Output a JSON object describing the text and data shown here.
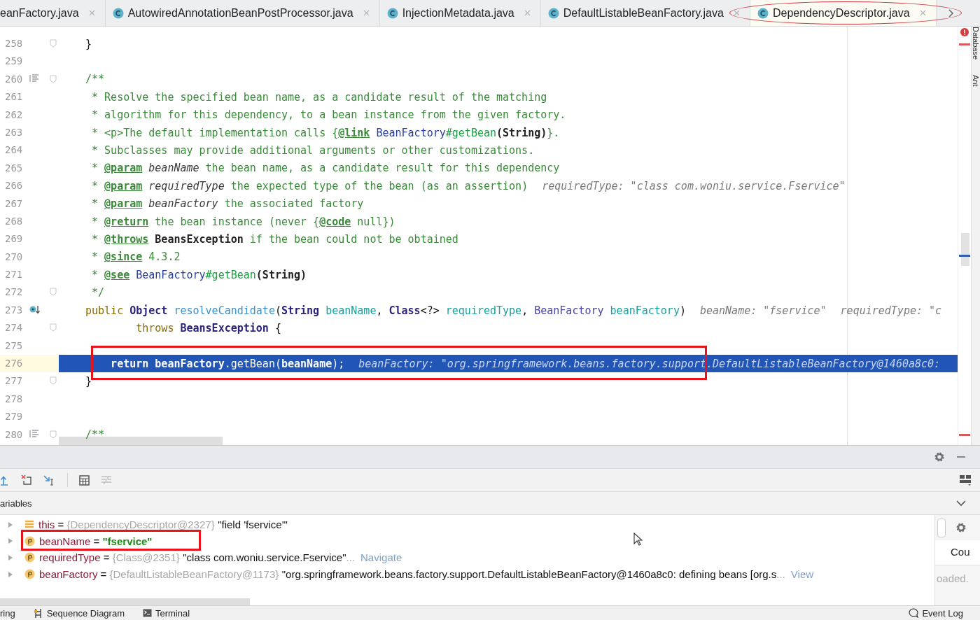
{
  "tabs": [
    {
      "label": "eanFactory.java",
      "kind": "cut",
      "selected": false,
      "annotated": false
    },
    {
      "label": "AutowiredAnnotationBeanPostProcessor.java",
      "kind": "class",
      "selected": false,
      "annotated": false
    },
    {
      "label": "InjectionMetadata.java",
      "kind": "class",
      "selected": false,
      "annotated": false
    },
    {
      "label": "DefaultListableBeanFactory.java",
      "kind": "class",
      "selected": false,
      "annotated": false
    },
    {
      "label": "DependencyDescriptor.java",
      "kind": "class",
      "selected": true,
      "annotated": true
    }
  ],
  "editor": {
    "lines": [
      {
        "number": "258",
        "fold": true,
        "current": false,
        "annotated": false,
        "tokens": [
          {
            "kind": "plain",
            "text": "}"
          }
        ]
      },
      {
        "number": "259",
        "fold": false,
        "current": false,
        "annotated": false
      },
      {
        "number": "260",
        "gutter_icon": {
          "kind": "javadoc"
        },
        "fold": true,
        "current": false,
        "annotated": false,
        "tokens": [
          {
            "kind": "comment",
            "text": "/**"
          }
        ]
      },
      {
        "number": "261",
        "fold": false,
        "current": false,
        "annotated": false,
        "tokens": [
          {
            "kind": "comment",
            "text": " * Resolve the specified bean name, as a candidate result of the matching"
          }
        ]
      },
      {
        "number": "262",
        "fold": false,
        "current": false,
        "annotated": false,
        "tokens": [
          {
            "kind": "comment",
            "text": " * algorithm for this dependency, to a bean instance from the given factory."
          }
        ]
      },
      {
        "number": "263",
        "fold": false,
        "current": false,
        "annotated": false,
        "tokens": [
          {
            "kind": "comment",
            "text": " * "
          },
          {
            "kind": "html",
            "text": "<p>"
          },
          {
            "kind": "comment",
            "text": "The default implementation calls {"
          },
          {
            "kind": "tag",
            "text": "@link"
          },
          {
            "kind": "docref",
            "text": " BeanFactory"
          },
          {
            "kind": "docmember",
            "text": "#getBean"
          },
          {
            "kind": "docbold",
            "text": "(String)"
          },
          {
            "kind": "comment",
            "text": "}."
          }
        ]
      },
      {
        "number": "264",
        "fold": false,
        "current": false,
        "annotated": false,
        "tokens": [
          {
            "kind": "comment",
            "text": " * Subclasses may provide additional arguments or other customizations."
          }
        ]
      },
      {
        "number": "265",
        "fold": false,
        "current": false,
        "annotated": false,
        "tokens": [
          {
            "kind": "comment",
            "text": " * "
          },
          {
            "kind": "tag",
            "text": "@param"
          },
          {
            "kind": "docparam",
            "text": " beanName"
          },
          {
            "kind": "comment",
            "text": " the bean name, as a candidate result for this dependency"
          }
        ]
      },
      {
        "number": "266",
        "fold": false,
        "current": false,
        "annotated": false,
        "tokens": [
          {
            "kind": "comment",
            "text": " * "
          },
          {
            "kind": "tag",
            "text": "@param"
          },
          {
            "kind": "docparam",
            "text": " requiredType"
          },
          {
            "kind": "comment",
            "text": " the expected type of the bean (as an assertion)"
          }
        ],
        "hints": [
          "requiredType: \"class com.woniu.service.Fservice\""
        ]
      },
      {
        "number": "267",
        "fold": false,
        "current": false,
        "annotated": false,
        "tokens": [
          {
            "kind": "comment",
            "text": " * "
          },
          {
            "kind": "tag",
            "text": "@param"
          },
          {
            "kind": "docparam",
            "text": " beanFactory"
          },
          {
            "kind": "comment",
            "text": " the associated factory"
          }
        ]
      },
      {
        "number": "268",
        "fold": false,
        "current": false,
        "annotated": false,
        "tokens": [
          {
            "kind": "comment",
            "text": " * "
          },
          {
            "kind": "tag",
            "text": "@return"
          },
          {
            "kind": "comment",
            "text": " the bean instance (never {"
          },
          {
            "kind": "tag",
            "text": "@code"
          },
          {
            "kind": "comment",
            "text": " null})"
          }
        ]
      },
      {
        "number": "269",
        "fold": false,
        "current": false,
        "annotated": false,
        "tokens": [
          {
            "kind": "comment",
            "text": " * "
          },
          {
            "kind": "tag",
            "text": "@throws"
          },
          {
            "kind": "docbold",
            "text": " BeansException"
          },
          {
            "kind": "comment",
            "text": " if the bean could not be obtained"
          }
        ]
      },
      {
        "number": "270",
        "fold": false,
        "current": false,
        "annotated": false,
        "tokens": [
          {
            "kind": "comment",
            "text": " * "
          },
          {
            "kind": "tag",
            "text": "@since"
          },
          {
            "kind": "comment",
            "text": " 4.3.2"
          }
        ]
      },
      {
        "number": "271",
        "fold": false,
        "current": false,
        "annotated": false,
        "tokens": [
          {
            "kind": "comment",
            "text": " * "
          },
          {
            "kind": "tag",
            "text": "@see"
          },
          {
            "kind": "docref",
            "text": " BeanFactory"
          },
          {
            "kind": "docmember",
            "text": "#getBean"
          },
          {
            "kind": "docbold",
            "text": "(String)"
          }
        ]
      },
      {
        "number": "272",
        "fold": true,
        "current": false,
        "annotated": false,
        "tokens": [
          {
            "kind": "comment",
            "text": " */"
          }
        ]
      },
      {
        "number": "273",
        "gutter_icon": {
          "kind": "override"
        },
        "fold": false,
        "current": false,
        "annotated": false,
        "tokens": [
          {
            "kind": "keyword",
            "text": "public "
          },
          {
            "kind": "type",
            "text": "Object "
          },
          {
            "kind": "method",
            "text": "resolveCandidate"
          },
          {
            "kind": "plain",
            "text": "("
          },
          {
            "kind": "type",
            "text": "String "
          },
          {
            "kind": "param",
            "text": "beanName"
          },
          {
            "kind": "plain",
            "text": ", "
          },
          {
            "kind": "type",
            "text": "Class"
          },
          {
            "kind": "plain",
            "text": "<?> "
          },
          {
            "kind": "param",
            "text": "requiredType"
          },
          {
            "kind": "plain",
            "text": ", "
          },
          {
            "kind": "type2",
            "text": "BeanFactory "
          },
          {
            "kind": "param",
            "text": "beanFactory"
          },
          {
            "kind": "plain",
            "text": ")"
          }
        ],
        "hints": [
          "beanName: \"fservice\"",
          "requiredType: \"c"
        ]
      },
      {
        "number": "274",
        "fold": true,
        "current": false,
        "annotated": false,
        "tokens": [
          {
            "kind": "keyword",
            "text": "        throws "
          },
          {
            "kind": "type",
            "text": "BeansException"
          },
          {
            "kind": "plain",
            "text": " {"
          }
        ]
      },
      {
        "number": "275",
        "fold": false,
        "current": false,
        "annotated": false
      },
      {
        "number": "276",
        "fold": false,
        "current": true,
        "annotated": true,
        "tokens": [
          {
            "kind": "keyword",
            "text": "    return "
          },
          {
            "kind": "bold",
            "text": "beanFactory"
          },
          {
            "kind": "plain",
            "text": ".getBean("
          },
          {
            "kind": "bold",
            "text": "beanName"
          },
          {
            "kind": "plain",
            "text": ");"
          }
        ],
        "hints": [
          "beanFactory: \"org.springframework.beans.factory.support.DefaultListableBeanFactory@1460a8c0:"
        ]
      },
      {
        "number": "277",
        "fold": true,
        "current": false,
        "annotated": false,
        "tokens": [
          {
            "kind": "plain",
            "text": "}"
          }
        ]
      },
      {
        "number": "278",
        "fold": false,
        "current": false,
        "annotated": false
      },
      {
        "number": "279",
        "fold": false,
        "current": false,
        "annotated": false
      },
      {
        "number": "280",
        "gutter_icon": {
          "kind": "javadoc"
        },
        "fold": true,
        "current": false,
        "annotated": false,
        "tokens": [
          {
            "kind": "comment",
            "text": "/**"
          }
        ]
      }
    ]
  },
  "side_tools": [
    "Database",
    "Ant"
  ],
  "debugger": {
    "section_title": "ariables",
    "variables": [
      {
        "kind": "field",
        "name": "this",
        "operator": "=",
        "ref": "{DependencyDescriptor@2327}",
        "value": "\"field 'fservice'\"",
        "string_literal": false,
        "expanded": false,
        "annotated": false
      },
      {
        "kind": "param",
        "name": "beanName",
        "operator": "=",
        "value": "\"fservice\"",
        "string_literal": true,
        "expanded": false,
        "annotated": true
      },
      {
        "kind": "param",
        "name": "requiredType",
        "operator": "=",
        "ref": "{Class@2351}",
        "value": "\"class com.woniu.service.Fservice\"",
        "string_literal": false,
        "more": "...",
        "link": "Navigate",
        "expanded": false,
        "annotated": false
      },
      {
        "kind": "param",
        "name": "beanFactory",
        "operator": "=",
        "ref": "{DefaultListableBeanFactory@1173}",
        "value": "\"org.springframework.beans.factory.support.DefaultListableBeanFactory@1460a8c0: defining beans [org.s",
        "string_literal": false,
        "more": "...",
        "link": "View",
        "expanded": false,
        "annotated": false
      }
    ],
    "side_texts": [
      "Cou",
      "oaded."
    ]
  },
  "status_bar": {
    "items": [
      {
        "label": "ring",
        "kind": "cut"
      },
      {
        "label": "Sequence Diagram",
        "kind": "sequence"
      },
      {
        "label": "Terminal",
        "kind": "terminal"
      }
    ],
    "right": "Event Log"
  }
}
